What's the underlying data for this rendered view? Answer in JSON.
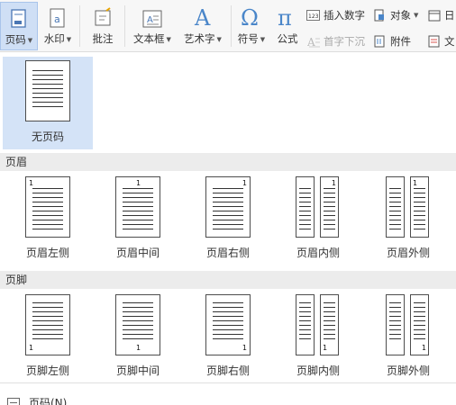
{
  "ribbon": {
    "page_number": {
      "label": "页码",
      "active": true
    },
    "watermark": {
      "label": "水印"
    },
    "comment": {
      "label": "批注"
    },
    "textbox": {
      "label": "文本框"
    },
    "art_text": {
      "label": "艺术字"
    },
    "symbol": {
      "label": "符号"
    },
    "formula": {
      "label": "公式"
    },
    "insert_number": {
      "label": "插入数字"
    },
    "object": {
      "label": "对象"
    },
    "date": {
      "label": "日"
    },
    "drop_cap": {
      "label": "首字下沉",
      "disabled": true
    },
    "attachment": {
      "label": "附件"
    },
    "doc_part": {
      "label": "文"
    }
  },
  "panel": {
    "none": {
      "label": "无页码"
    },
    "header_section": {
      "title": "页眉",
      "items": [
        {
          "label": "页眉左侧",
          "number": "1"
        },
        {
          "label": "页眉中间",
          "number": "1"
        },
        {
          "label": "页眉右侧",
          "number": "1"
        },
        {
          "label": "页眉内侧",
          "number": "1"
        },
        {
          "label": "页眉外侧",
          "number": "1"
        }
      ]
    },
    "footer_section": {
      "title": "页脚",
      "items": [
        {
          "label": "页脚左侧",
          "number": "1"
        },
        {
          "label": "页脚中间",
          "number": "1"
        },
        {
          "label": "页脚右侧",
          "number": "1"
        },
        {
          "label": "页脚内侧",
          "number": "1"
        },
        {
          "label": "页脚外侧",
          "number": "1"
        }
      ]
    },
    "bottom_item": {
      "label": "页码(N)..."
    }
  },
  "colors": {
    "active_bg": "#cfdff5",
    "selected_bg": "#d4e3f7",
    "section_bg": "#ececec"
  }
}
